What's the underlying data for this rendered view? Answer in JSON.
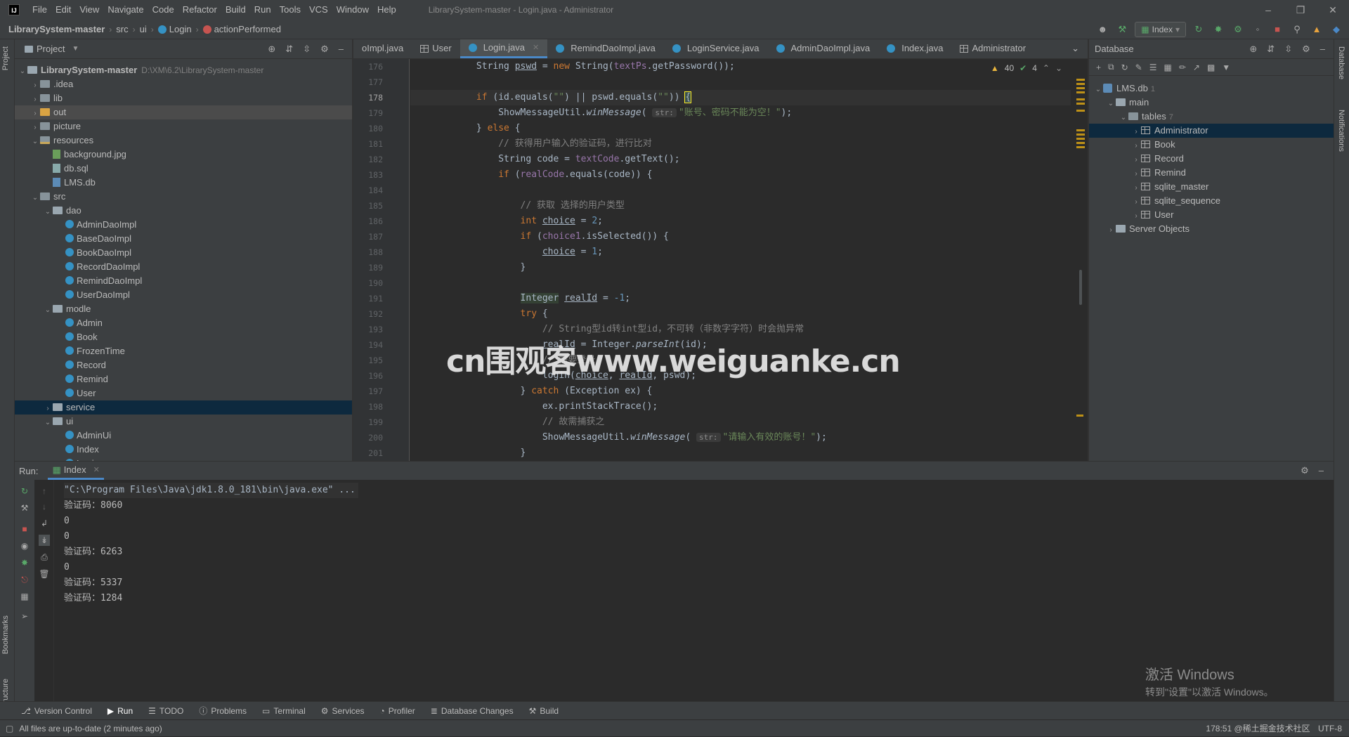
{
  "titlebar": {
    "menu": [
      "File",
      "Edit",
      "View",
      "Navigate",
      "Code",
      "Refactor",
      "Build",
      "Run",
      "Tools",
      "VCS",
      "Window",
      "Help"
    ],
    "title": "LibrarySystem-master - Login.java - Administrator"
  },
  "navbar": {
    "crumbs": [
      "LibrarySystem-master",
      "src",
      "ui",
      "Login",
      "actionPerformed"
    ],
    "run_config": "Index"
  },
  "project": {
    "header": "Project",
    "root_name": "LibrarySystem-master",
    "root_path": "D:\\XM\\6.2\\LibrarySystem-master",
    "items": [
      ".idea",
      "lib",
      "out",
      "picture",
      "resources",
      "background.jpg",
      "db.sql",
      "LMS.db",
      "src",
      "dao",
      "AdminDaoImpl",
      "BaseDaoImpl",
      "BookDaoImpl",
      "RecordDaoImpl",
      "RemindDaoImpl",
      "UserDaoImpl",
      "modle",
      "Admin",
      "Book",
      "FrozenTime",
      "Record",
      "Remind",
      "User",
      "service",
      "ui",
      "AdminUi",
      "Index",
      "Login"
    ]
  },
  "editor": {
    "tabs": [
      "oImpl.java",
      "User",
      "Login.java",
      "RemindDaoImpl.java",
      "LoginService.java",
      "AdminDaoImpl.java",
      "Index.java",
      "Administrator"
    ],
    "warnings": "40",
    "oks": "4",
    "line_numbers": [
      "176",
      "177",
      "178",
      "179",
      "180",
      "181",
      "182",
      "183",
      "184",
      "185",
      "186",
      "187",
      "188",
      "189",
      "190",
      "191",
      "192",
      "193",
      "194",
      "195",
      "196",
      "197",
      "198",
      "199",
      "200",
      "201"
    ],
    "hint_str": "str:",
    "msg_empty": "\"账号、密码不能为空！\"",
    "msg_invalid": "\"请输入有效的账号！\"",
    "cmt_verify": "// 获得用户输入的验证码，进行比对",
    "cmt_usertype": "// 获取 选择的用户类型",
    "cmt_convert": "// String型id转int型id，不可转（非数字字符）时会抛异常",
    "cmt_login": "// 需要登录",
    "cmt_catch": "// 故需捕获之"
  },
  "database": {
    "header": "Database",
    "db": "LMS.db",
    "db_count": "1",
    "schema": "main",
    "tables_label": "tables",
    "tables_count": "7",
    "tables": [
      "Administrator",
      "Book",
      "Record",
      "Remind",
      "sqlite_master",
      "sqlite_sequence",
      "User"
    ],
    "server_objects": "Server Objects"
  },
  "run": {
    "label": "Run:",
    "tab": "Index",
    "console": [
      "\"C:\\Program Files\\Java\\jdk1.8.0_181\\bin\\java.exe\" ...",
      "验证码：8060",
      "0",
      "0",
      "验证码：6263",
      "0",
      "验证码：5337",
      "验证码：1284"
    ]
  },
  "bottom_tabs": [
    "Version Control",
    "Run",
    "TODO",
    "Problems",
    "Terminal",
    "Services",
    "Profiler",
    "Database Changes",
    "Build"
  ],
  "status": {
    "message": "All files are up-to-date (2 minutes ago)",
    "position": "178:51",
    "encoding": "UTF-8",
    "extra": "@稀土掘金技术社区"
  },
  "side_tabs": {
    "left": [
      "Project",
      "Bookmarks",
      "Structure"
    ],
    "right": [
      "Database",
      "Notifications"
    ]
  },
  "overlay": {
    "watermark": "cn围观客www.weiguanke.cn",
    "activate_title": "激活 Windows",
    "activate_sub": "转到\"设置\"以激活 Windows。"
  },
  "colors": {
    "accent": "#4a88c7",
    "selection": "#0d293e",
    "keyword": "#cc7832",
    "string": "#6a8759",
    "comment": "#808080",
    "field": "#9876aa"
  }
}
